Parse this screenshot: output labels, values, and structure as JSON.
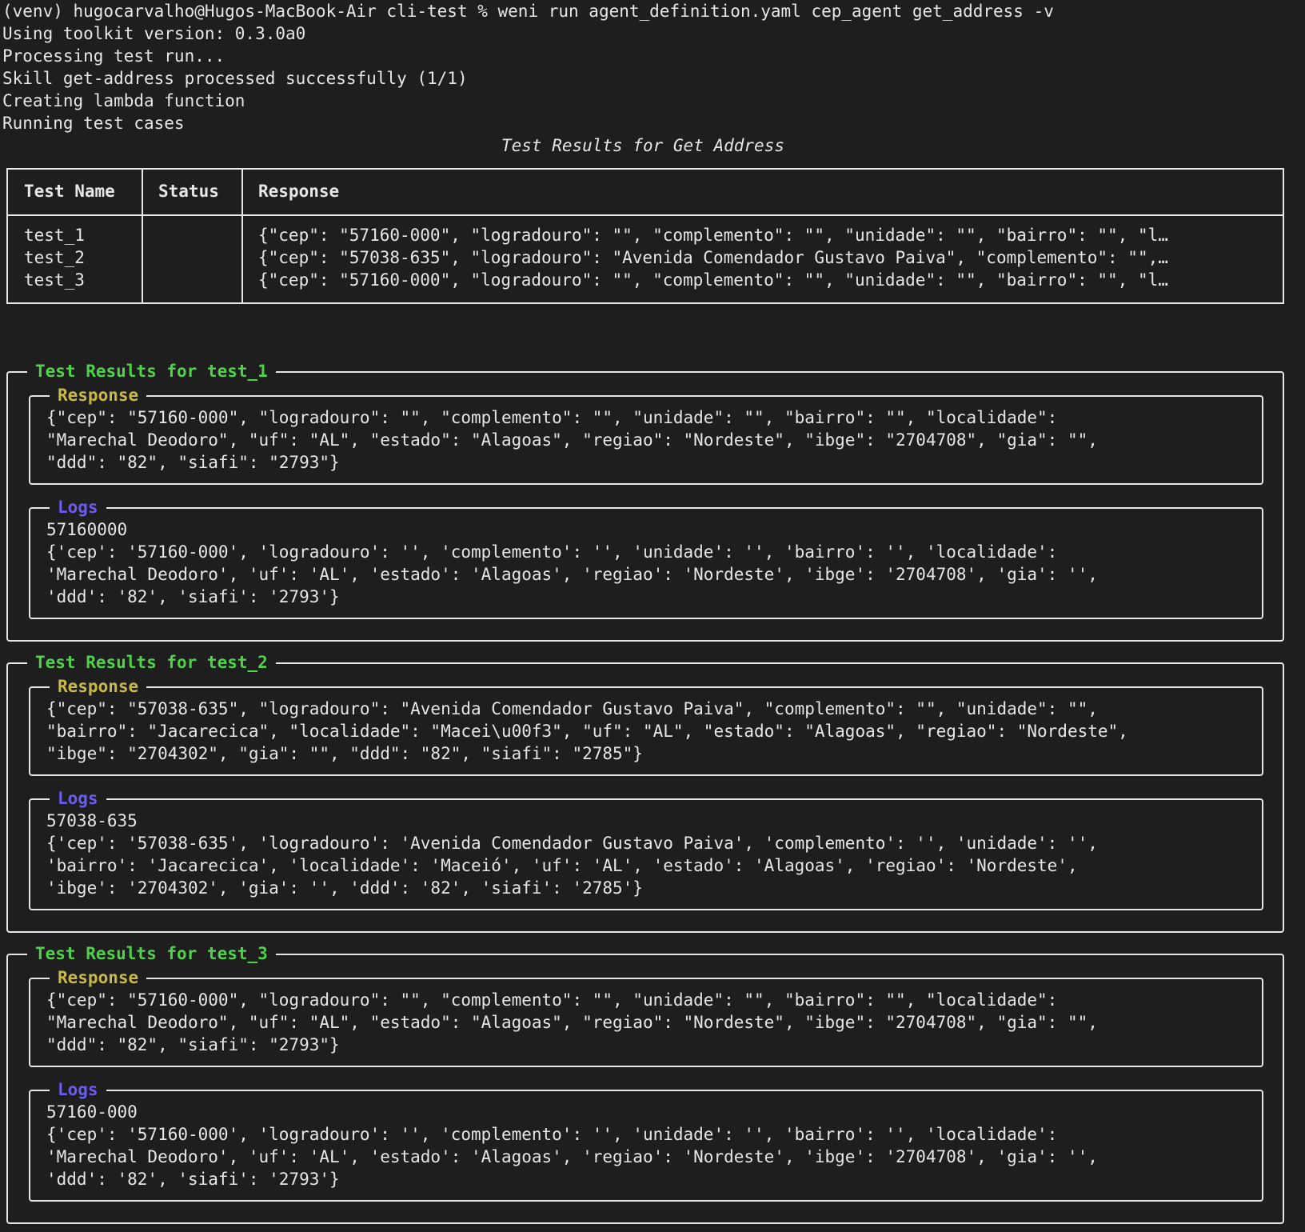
{
  "terminal": {
    "command_line": "(venv) hugocarvalho@Hugos-MacBook-Air cli-test % weni run agent_definition.yaml cep_agent get_address -v",
    "output_lines": [
      "Using toolkit version: 0.3.0a0",
      "Processing test run...",
      "Skill get-address processed successfully (1/1)",
      "Creating lambda function",
      "Running test cases"
    ]
  },
  "summary_table": {
    "title": "Test Results for Get Address",
    "headers": [
      "Test Name",
      "Status",
      "Response"
    ],
    "status_icon": "check-mark-button-icon",
    "status_color": "#3fb44f",
    "rows": [
      {
        "name": "test_1",
        "status": "✓",
        "response": "{\"cep\": \"57160-000\", \"logradouro\": \"\", \"complemento\": \"\", \"unidade\": \"\", \"bairro\": \"\", \"l…"
      },
      {
        "name": "test_2",
        "status": "✓",
        "response": "{\"cep\": \"57038-635\", \"logradouro\": \"Avenida Comendador Gustavo Paiva\", \"complemento\": \"\",…"
      },
      {
        "name": "test_3",
        "status": "✓",
        "response": "{\"cep\": \"57160-000\", \"logradouro\": \"\", \"complemento\": \"\", \"unidade\": \"\", \"bairro\": \"\", \"l…"
      }
    ]
  },
  "colors": {
    "background": "#1e1e1e",
    "text": "#e6e6e6",
    "panel_title": "#4fd14a",
    "response_title": "#c8b84a",
    "logs_title": "#6a5cf0"
  },
  "panels": [
    {
      "title": "Test Results for test_1",
      "response_label": "Response",
      "response_lines": [
        "{\"cep\": \"57160-000\", \"logradouro\": \"\", \"complemento\": \"\", \"unidade\": \"\", \"bairro\": \"\", \"localidade\":",
        "\"Marechal Deodoro\", \"uf\": \"AL\", \"estado\": \"Alagoas\", \"regiao\": \"Nordeste\", \"ibge\": \"2704708\", \"gia\": \"\",",
        "\"ddd\": \"82\", \"siafi\": \"2793\"}"
      ],
      "logs_label": "Logs",
      "logs_lines": [
        "57160000",
        "{'cep': '57160-000', 'logradouro': '', 'complemento': '', 'unidade': '', 'bairro': '', 'localidade':",
        "'Marechal Deodoro', 'uf': 'AL', 'estado': 'Alagoas', 'regiao': 'Nordeste', 'ibge': '2704708', 'gia': '',",
        "'ddd': '82', 'siafi': '2793'}"
      ]
    },
    {
      "title": "Test Results for test_2",
      "response_label": "Response",
      "response_lines": [
        "{\"cep\": \"57038-635\", \"logradouro\": \"Avenida Comendador Gustavo Paiva\", \"complemento\": \"\", \"unidade\": \"\",",
        "\"bairro\": \"Jacarecica\", \"localidade\": \"Macei\\u00f3\", \"uf\": \"AL\", \"estado\": \"Alagoas\", \"regiao\": \"Nordeste\",",
        "\"ibge\": \"2704302\", \"gia\": \"\", \"ddd\": \"82\", \"siafi\": \"2785\"}"
      ],
      "logs_label": "Logs",
      "logs_lines": [
        "57038-635",
        "{'cep': '57038-635', 'logradouro': 'Avenida Comendador Gustavo Paiva', 'complemento': '', 'unidade': '',",
        "'bairro': 'Jacarecica', 'localidade': 'Maceió', 'uf': 'AL', 'estado': 'Alagoas', 'regiao': 'Nordeste',",
        "'ibge': '2704302', 'gia': '', 'ddd': '82', 'siafi': '2785'}"
      ]
    },
    {
      "title": "Test Results for test_3",
      "response_label": "Response",
      "response_lines": [
        "{\"cep\": \"57160-000\", \"logradouro\": \"\", \"complemento\": \"\", \"unidade\": \"\", \"bairro\": \"\", \"localidade\":",
        "\"Marechal Deodoro\", \"uf\": \"AL\", \"estado\": \"Alagoas\", \"regiao\": \"Nordeste\", \"ibge\": \"2704708\", \"gia\": \"\",",
        "\"ddd\": \"82\", \"siafi\": \"2793\"}"
      ],
      "logs_label": "Logs",
      "logs_lines": [
        "57160-000",
        "{'cep': '57160-000', 'logradouro': '', 'complemento': '', 'unidade': '', 'bairro': '', 'localidade':",
        "'Marechal Deodoro', 'uf': 'AL', 'estado': 'Alagoas', 'regiao': 'Nordeste', 'ibge': '2704708', 'gia': '',",
        "'ddd': '82', 'siafi': '2793'}"
      ]
    }
  ]
}
